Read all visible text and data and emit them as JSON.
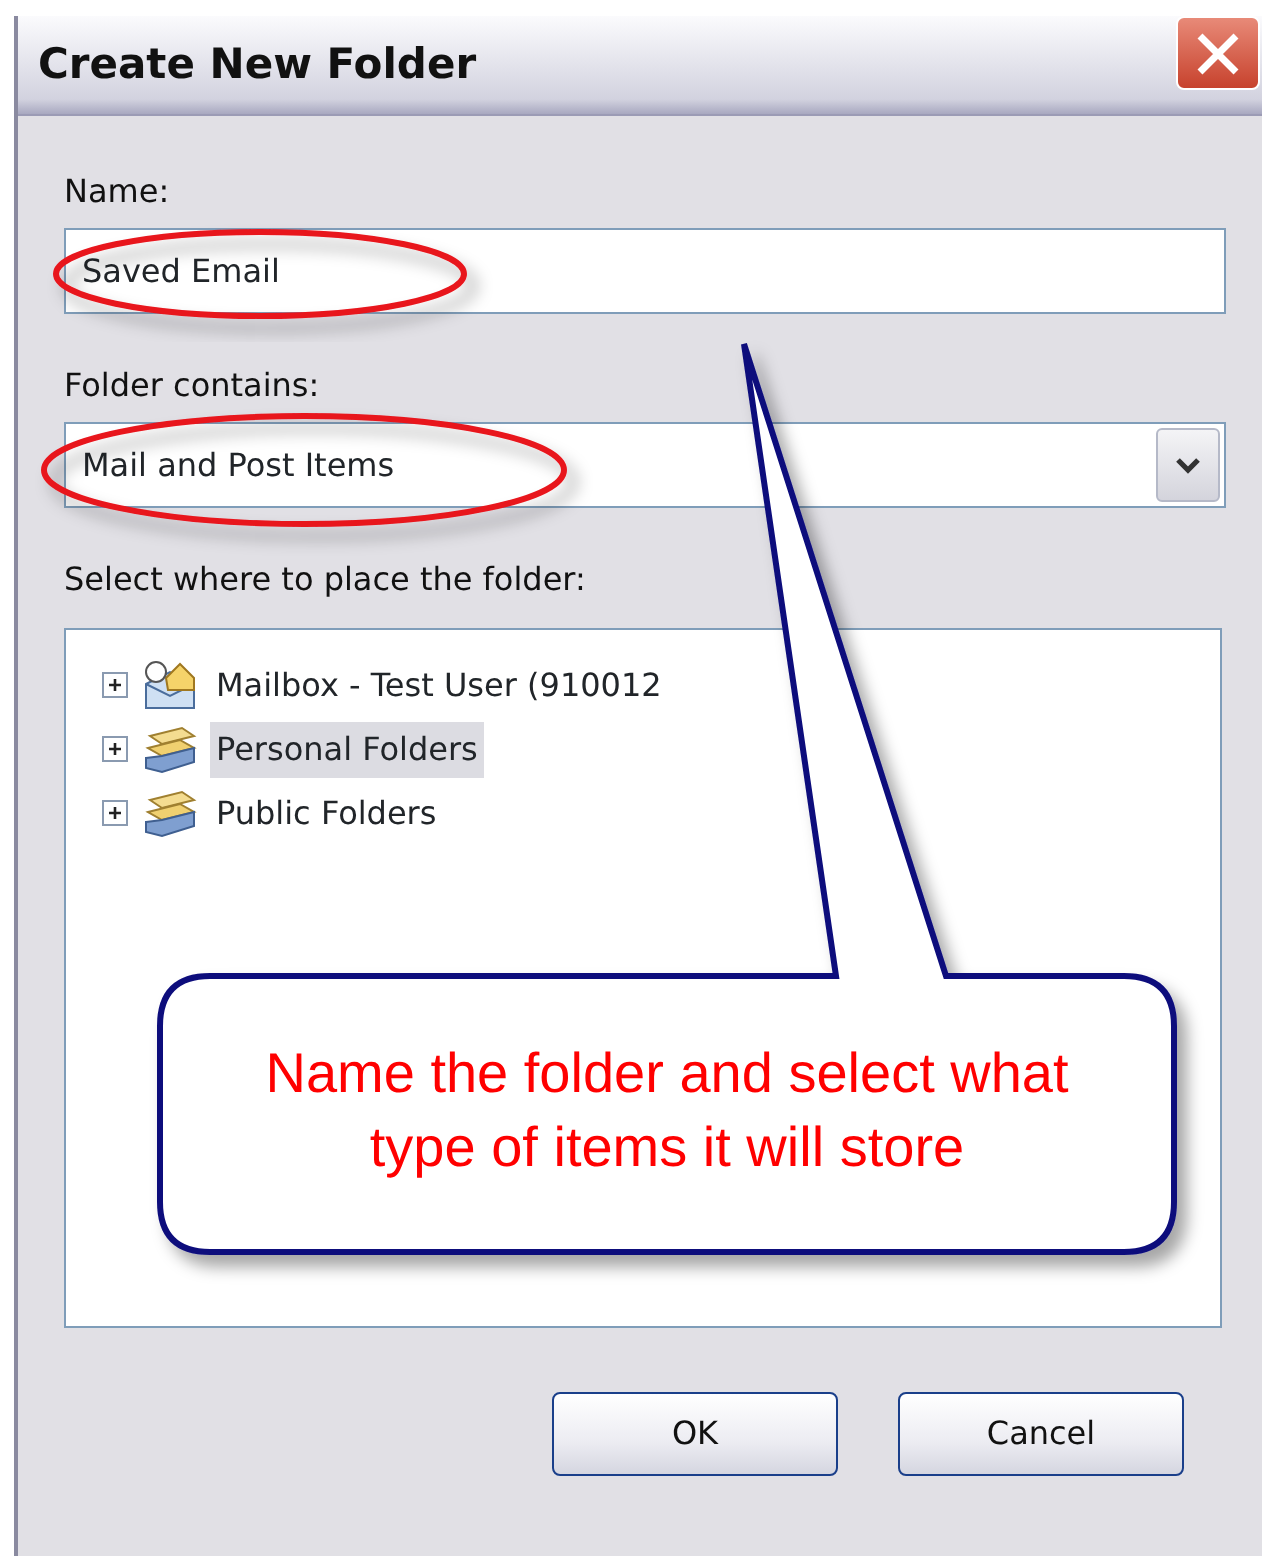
{
  "window": {
    "title": "Create New Folder"
  },
  "name_field": {
    "label": "Name:",
    "value": "Saved Email"
  },
  "contains_field": {
    "label": "Folder contains:",
    "value": "Mail and Post Items"
  },
  "location": {
    "label": "Select where to place the folder:",
    "tree": [
      {
        "label": "Mailbox - Test User (910012",
        "kind": "mailbox",
        "expanded": false,
        "selected": false
      },
      {
        "label": "Personal Folders",
        "kind": "folders",
        "expanded": false,
        "selected": true
      },
      {
        "label": "Public Folders",
        "kind": "folders",
        "expanded": false,
        "selected": false
      }
    ]
  },
  "buttons": [
    {
      "label": "OK"
    },
    {
      "label": "Cancel"
    }
  ],
  "annotation": {
    "text": "Name the folder and select what type of items it will store"
  }
}
